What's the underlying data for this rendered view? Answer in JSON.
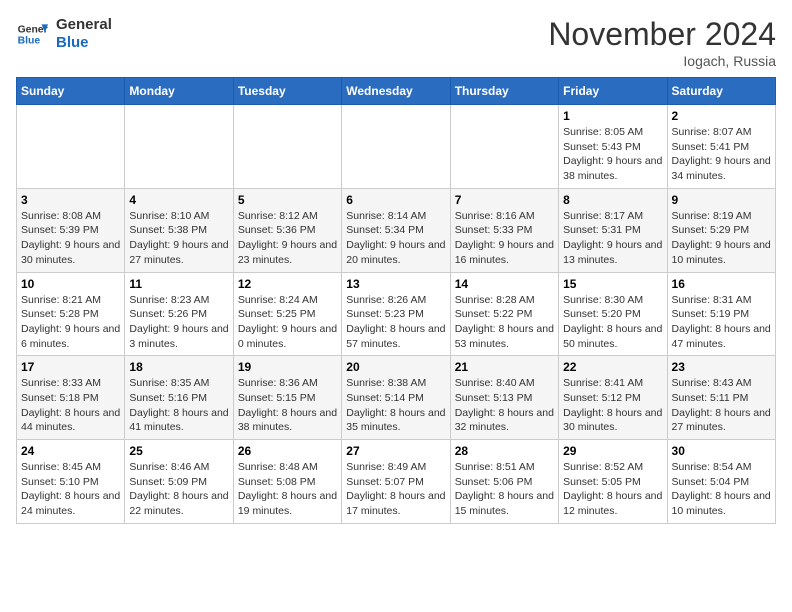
{
  "logo": {
    "general": "General",
    "blue": "Blue"
  },
  "title": "November 2024",
  "location": "Iogach, Russia",
  "days_header": [
    "Sunday",
    "Monday",
    "Tuesday",
    "Wednesday",
    "Thursday",
    "Friday",
    "Saturday"
  ],
  "weeks": [
    [
      {
        "day": "",
        "info": ""
      },
      {
        "day": "",
        "info": ""
      },
      {
        "day": "",
        "info": ""
      },
      {
        "day": "",
        "info": ""
      },
      {
        "day": "",
        "info": ""
      },
      {
        "day": "1",
        "info": "Sunrise: 8:05 AM\nSunset: 5:43 PM\nDaylight: 9 hours and 38 minutes."
      },
      {
        "day": "2",
        "info": "Sunrise: 8:07 AM\nSunset: 5:41 PM\nDaylight: 9 hours and 34 minutes."
      }
    ],
    [
      {
        "day": "3",
        "info": "Sunrise: 8:08 AM\nSunset: 5:39 PM\nDaylight: 9 hours and 30 minutes."
      },
      {
        "day": "4",
        "info": "Sunrise: 8:10 AM\nSunset: 5:38 PM\nDaylight: 9 hours and 27 minutes."
      },
      {
        "day": "5",
        "info": "Sunrise: 8:12 AM\nSunset: 5:36 PM\nDaylight: 9 hours and 23 minutes."
      },
      {
        "day": "6",
        "info": "Sunrise: 8:14 AM\nSunset: 5:34 PM\nDaylight: 9 hours and 20 minutes."
      },
      {
        "day": "7",
        "info": "Sunrise: 8:16 AM\nSunset: 5:33 PM\nDaylight: 9 hours and 16 minutes."
      },
      {
        "day": "8",
        "info": "Sunrise: 8:17 AM\nSunset: 5:31 PM\nDaylight: 9 hours and 13 minutes."
      },
      {
        "day": "9",
        "info": "Sunrise: 8:19 AM\nSunset: 5:29 PM\nDaylight: 9 hours and 10 minutes."
      }
    ],
    [
      {
        "day": "10",
        "info": "Sunrise: 8:21 AM\nSunset: 5:28 PM\nDaylight: 9 hours and 6 minutes."
      },
      {
        "day": "11",
        "info": "Sunrise: 8:23 AM\nSunset: 5:26 PM\nDaylight: 9 hours and 3 minutes."
      },
      {
        "day": "12",
        "info": "Sunrise: 8:24 AM\nSunset: 5:25 PM\nDaylight: 9 hours and 0 minutes."
      },
      {
        "day": "13",
        "info": "Sunrise: 8:26 AM\nSunset: 5:23 PM\nDaylight: 8 hours and 57 minutes."
      },
      {
        "day": "14",
        "info": "Sunrise: 8:28 AM\nSunset: 5:22 PM\nDaylight: 8 hours and 53 minutes."
      },
      {
        "day": "15",
        "info": "Sunrise: 8:30 AM\nSunset: 5:20 PM\nDaylight: 8 hours and 50 minutes."
      },
      {
        "day": "16",
        "info": "Sunrise: 8:31 AM\nSunset: 5:19 PM\nDaylight: 8 hours and 47 minutes."
      }
    ],
    [
      {
        "day": "17",
        "info": "Sunrise: 8:33 AM\nSunset: 5:18 PM\nDaylight: 8 hours and 44 minutes."
      },
      {
        "day": "18",
        "info": "Sunrise: 8:35 AM\nSunset: 5:16 PM\nDaylight: 8 hours and 41 minutes."
      },
      {
        "day": "19",
        "info": "Sunrise: 8:36 AM\nSunset: 5:15 PM\nDaylight: 8 hours and 38 minutes."
      },
      {
        "day": "20",
        "info": "Sunrise: 8:38 AM\nSunset: 5:14 PM\nDaylight: 8 hours and 35 minutes."
      },
      {
        "day": "21",
        "info": "Sunrise: 8:40 AM\nSunset: 5:13 PM\nDaylight: 8 hours and 32 minutes."
      },
      {
        "day": "22",
        "info": "Sunrise: 8:41 AM\nSunset: 5:12 PM\nDaylight: 8 hours and 30 minutes."
      },
      {
        "day": "23",
        "info": "Sunrise: 8:43 AM\nSunset: 5:11 PM\nDaylight: 8 hours and 27 minutes."
      }
    ],
    [
      {
        "day": "24",
        "info": "Sunrise: 8:45 AM\nSunset: 5:10 PM\nDaylight: 8 hours and 24 minutes."
      },
      {
        "day": "25",
        "info": "Sunrise: 8:46 AM\nSunset: 5:09 PM\nDaylight: 8 hours and 22 minutes."
      },
      {
        "day": "26",
        "info": "Sunrise: 8:48 AM\nSunset: 5:08 PM\nDaylight: 8 hours and 19 minutes."
      },
      {
        "day": "27",
        "info": "Sunrise: 8:49 AM\nSunset: 5:07 PM\nDaylight: 8 hours and 17 minutes."
      },
      {
        "day": "28",
        "info": "Sunrise: 8:51 AM\nSunset: 5:06 PM\nDaylight: 8 hours and 15 minutes."
      },
      {
        "day": "29",
        "info": "Sunrise: 8:52 AM\nSunset: 5:05 PM\nDaylight: 8 hours and 12 minutes."
      },
      {
        "day": "30",
        "info": "Sunrise: 8:54 AM\nSunset: 5:04 PM\nDaylight: 8 hours and 10 minutes."
      }
    ]
  ]
}
